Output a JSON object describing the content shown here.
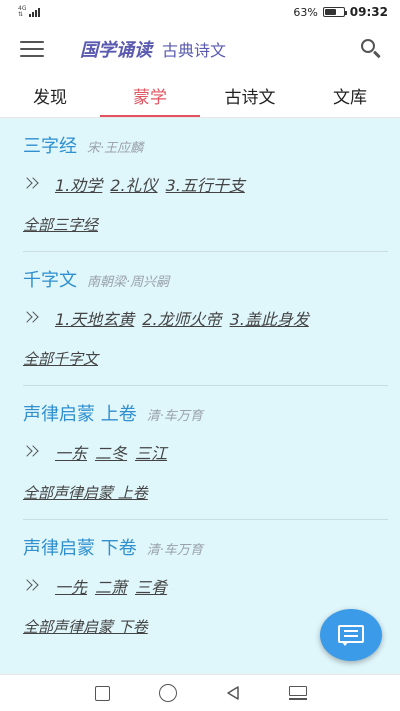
{
  "status_bar": {
    "network_top": "4G",
    "network_bottom": "⇅",
    "battery_text": "63%",
    "battery_level": 0.63,
    "time": "09:32"
  },
  "app_bar": {
    "title": "国学诵读",
    "subtitle": "古典诗文",
    "menu_icon": "hamburger-icon",
    "search_icon": "search-icon"
  },
  "tabs": [
    {
      "label": "发现",
      "active": false
    },
    {
      "label": "蒙学",
      "active": true
    },
    {
      "label": "古诗文",
      "active": false
    },
    {
      "label": "文库",
      "active": false
    }
  ],
  "books": [
    {
      "title": "三字经",
      "author": "宋·王应麟",
      "chapters": [
        "1.劝学",
        "2.礼仪",
        "3.五行干支"
      ],
      "all_link": "全部三字经"
    },
    {
      "title": "千字文",
      "author": "南朝梁·周兴嗣",
      "chapters": [
        "1.天地玄黄",
        "2.龙师火帝",
        "3.盖此身发"
      ],
      "all_link": "全部千字文"
    },
    {
      "title": "声律启蒙 上卷",
      "author": "清·车万育",
      "chapters": [
        "一东",
        "二冬",
        "三江"
      ],
      "all_link": "全部声律启蒙 上卷"
    },
    {
      "title": "声律启蒙 下卷",
      "author": "清·车万育",
      "chapters": [
        "一先",
        "二萧",
        "三肴"
      ],
      "all_link": "全部声律启蒙 下卷"
    }
  ],
  "fab": {
    "icon": "chat-icon"
  },
  "colors": {
    "accent": "#e05560",
    "title_blue": "#2f8fcf",
    "app_title": "#5a5bb0",
    "content_bg": "#dff6fb",
    "fab": "#3b9be8"
  }
}
